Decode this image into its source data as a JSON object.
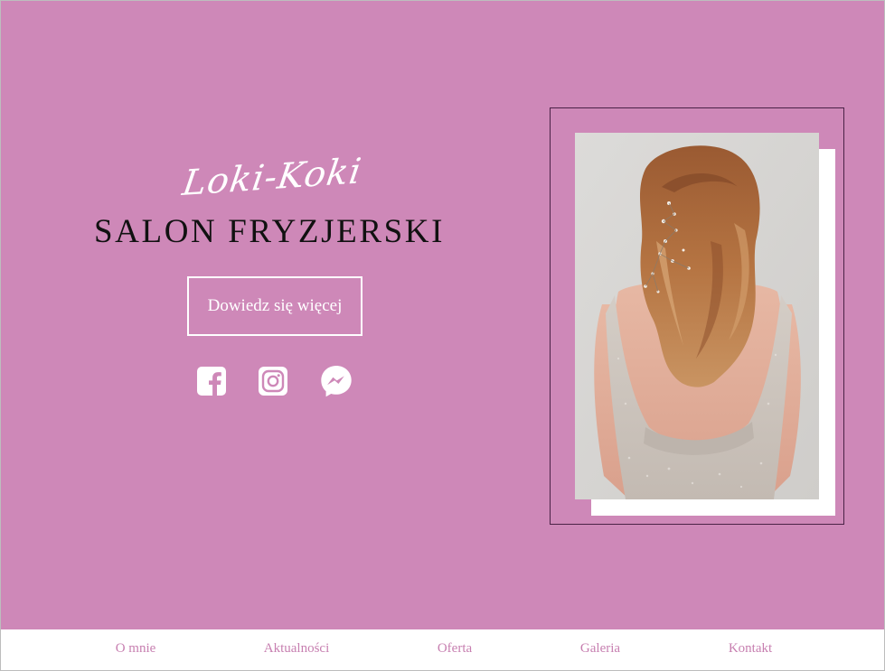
{
  "brand": {
    "script_name": "Loki-Koki",
    "subtitle": "SALON FRYZJERSKI"
  },
  "hero": {
    "cta_label": "Dowiedz się więcej",
    "background_color": "#ce88b8",
    "photo_alt": "Kobieta z długimi, falowanymi włosami upiętymi z ozdobami, widok od tyłu"
  },
  "social": [
    {
      "name": "facebook",
      "icon": "facebook-icon"
    },
    {
      "name": "instagram",
      "icon": "instagram-icon"
    },
    {
      "name": "messenger",
      "icon": "messenger-icon"
    }
  ],
  "nav": {
    "items": [
      {
        "label": "O mnie"
      },
      {
        "label": "Aktualności"
      },
      {
        "label": "Oferta"
      },
      {
        "label": "Galeria"
      },
      {
        "label": "Kontakt"
      }
    ],
    "text_color": "#c77fb0"
  }
}
